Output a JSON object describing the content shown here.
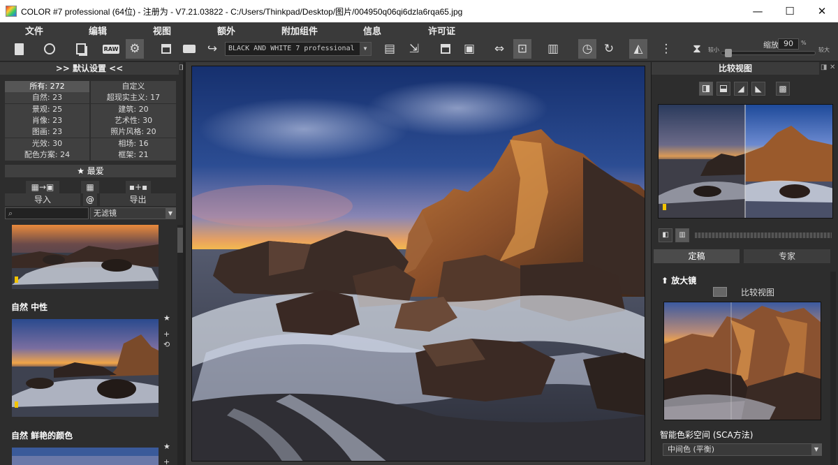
{
  "window": {
    "title": "COLOR #7 professional (64位) - 注册为 - V7.21.03822 - C:/Users/Thinkpad/Desktop/图片/004950q06qi6dzla6rqa65.jpg",
    "minimize": "—",
    "maximize": "☐",
    "close": "✕"
  },
  "menu": [
    "文件",
    "编辑",
    "视图",
    "额外",
    "附加组件",
    "信息",
    "许可证"
  ],
  "toolbar": {
    "preset_select": "BLACK AND WHITE 7 professional",
    "zoom_label": "缩放",
    "zoom_value": "90",
    "zoom_unit": "%",
    "zoom_small": "较小",
    "zoom_large": "较大",
    "zoom_level": 0.04
  },
  "left": {
    "title": ">>  默认设置  <<",
    "categories": [
      [
        "所有: 272",
        "自定义"
      ],
      [
        "自然: 23",
        "超现实主义: 17"
      ],
      [
        "景观: 25",
        "建筑: 20"
      ],
      [
        "肖像: 23",
        "艺术性: 30"
      ],
      [
        "图画: 23",
        "照片风格: 20"
      ],
      [
        "光效: 30",
        "相场: 16"
      ],
      [
        "配色方案: 24",
        "框架: 21"
      ]
    ],
    "favorites": "★ 最爱",
    "import": "导入",
    "at": "@",
    "export": "导出",
    "filter": "无滤镜",
    "preset_labels": [
      "自然  中性",
      "自然  鲜艳的颜色"
    ]
  },
  "right": {
    "title": "比较视图",
    "tabs": [
      "定稿",
      "专家"
    ],
    "loupe_head": "放大镜",
    "compare_label": "比较视图",
    "sca_label": "智能色彩空间 (SCA方法)",
    "sca_value": "中间色 (平衡)"
  },
  "colors": {
    "panel": "#2d2d2d",
    "toolbar": "#3a3a3a",
    "sky_top": "#1d3a7a",
    "sunset": "#f0a040"
  }
}
